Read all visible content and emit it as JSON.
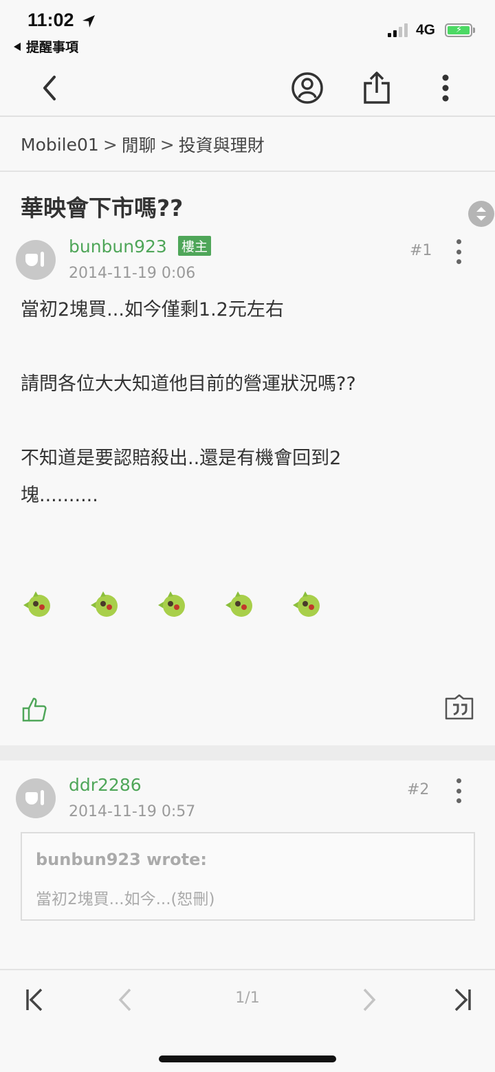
{
  "status_bar": {
    "time": "11:02",
    "back_app": "提醒事項",
    "network": "4G"
  },
  "toolbar": {
    "back_icon": "chevron-left-icon",
    "profile_icon": "user-circle-icon",
    "share_icon": "share-icon",
    "more_icon": "more-vertical-icon"
  },
  "breadcrumb": {
    "items": [
      "Mobile01",
      "閒聊",
      "投資與理財"
    ],
    "separator": ">"
  },
  "thread": {
    "title": "華映會下市嗎??"
  },
  "posts": [
    {
      "author": "bunbun923",
      "badge": "樓主",
      "timestamp": "2014-11-19 0:06",
      "floor": "#1",
      "body": [
        "當初2塊買...如今僅剩1.2元左右",
        "",
        "請問各位大大知道他目前的營運狀況嗎??",
        "",
        "不知道是要認賠殺出..還是有機會回到2",
        "塊.........."
      ],
      "emoji_count": 5
    },
    {
      "author": "ddr2286",
      "timestamp": "2014-11-19 0:57",
      "floor": "#2",
      "quote": {
        "author": "bunbun923 wrote:",
        "text": "當初2塊買...如今...(恕刪)"
      }
    }
  ],
  "pager": {
    "indicator": "1/1"
  },
  "colors": {
    "accent_green": "#4fa659",
    "background": "#f8f8f8",
    "muted_text": "#9a9a9a"
  }
}
